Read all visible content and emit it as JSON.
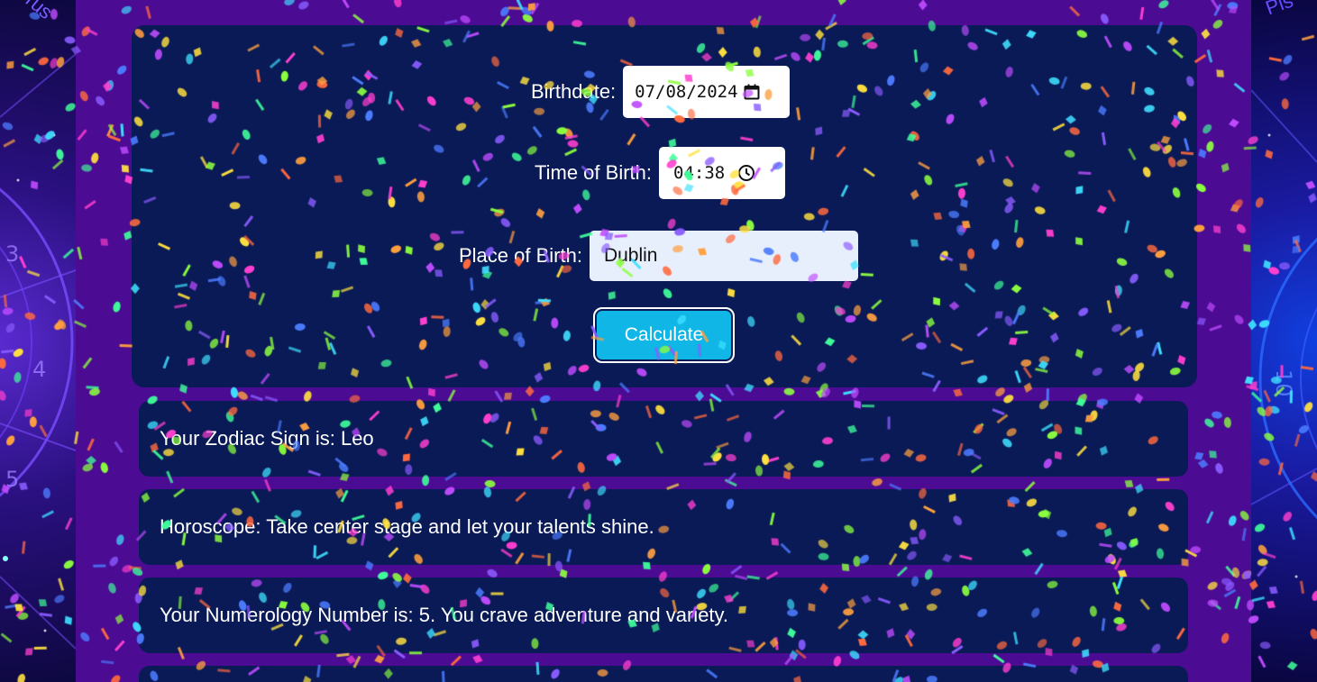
{
  "form": {
    "birthdate_label": "Birthdate:",
    "birthdate_value": "07/08/2024",
    "time_label": "Time of Birth:",
    "time_value": "04:38",
    "place_label": "Place of Birth:",
    "place_value": "Dublin",
    "calculate_label": "Calculate"
  },
  "results": {
    "zodiac": "Your Zodiac Sign is: Leo",
    "horoscope": "Horoscope: Take center stage and let your talents shine.",
    "numerology": "Your Numerology Number is: 5. You crave adventure and variety."
  },
  "background": {
    "side_left_text": "rus",
    "side_right_text": "Pis"
  },
  "colors": {
    "container": "#4b0b93",
    "card": "#0a1a56",
    "button": "#0fb6e6"
  }
}
